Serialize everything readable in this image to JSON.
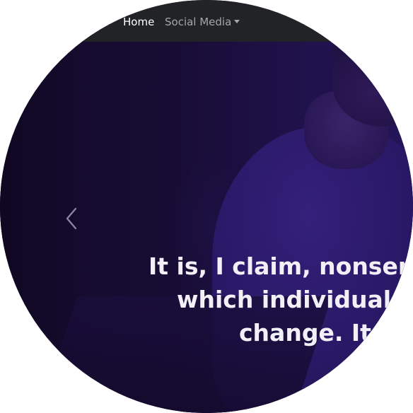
{
  "navbar": {
    "items": [
      {
        "label": "Home",
        "active": true
      },
      {
        "label": "Social Media",
        "dropdown": true
      }
    ]
  },
  "carousel": {
    "prev_icon": "chevron-left-icon",
    "caption_lines": [
      "It is, I claim, nonsens",
      "which individual",
      "change. It i"
    ]
  },
  "colors": {
    "navbar_bg": "#212327",
    "hero_overlay": "#150b2c",
    "caption_text": "#f2f0f7",
    "nav_active": "#ffffff",
    "nav_muted": "#a4a6a9"
  }
}
